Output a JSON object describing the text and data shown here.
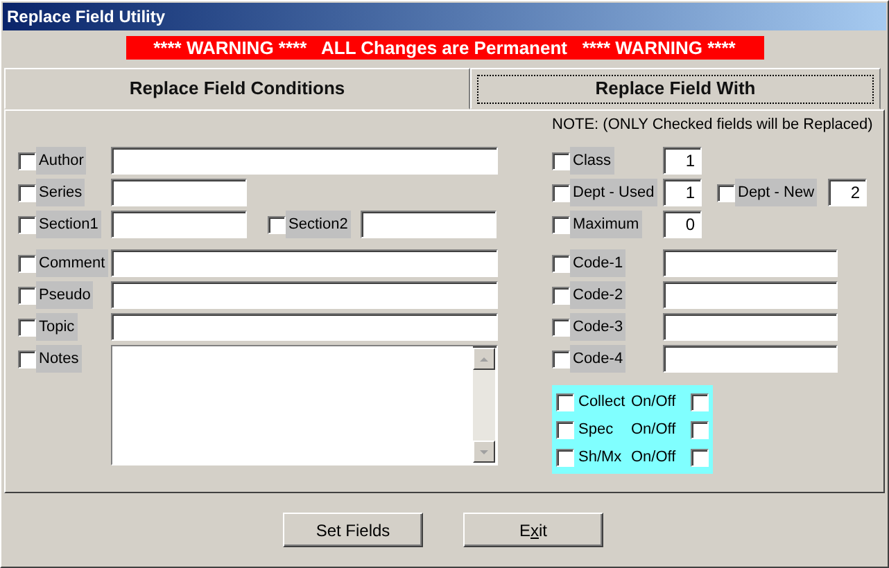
{
  "window": {
    "title": "Replace Field Utility"
  },
  "warning": "**** WARNING ****   ALL Changes are Permanent   **** WARNING ****",
  "sections": [
    {
      "header": "Replace Field Conditions",
      "focused": false
    },
    {
      "header": "Replace Field With",
      "focused": true
    }
  ],
  "note": "NOTE: (ONLY Checked fields will be Replaced)",
  "conditions": [
    [
      [
        {
          "label": "Author",
          "checked": false,
          "kind": "wide"
        }
      ],
      [
        {
          "label": "Series",
          "checked": false,
          "kind": "short"
        }
      ],
      [
        {
          "label": "Section1",
          "checked": false,
          "kind": "short"
        },
        {
          "label": "Section2",
          "checked": false,
          "kind": "short"
        }
      ]
    ],
    [
      [
        {
          "label": "Comment",
          "checked": false,
          "kind": "wide"
        }
      ],
      [
        {
          "label": "Pseudo",
          "checked": false,
          "kind": "wide"
        }
      ],
      [
        {
          "label": "Topic",
          "checked": false,
          "kind": "wide"
        }
      ],
      [
        {
          "label": "Notes",
          "checked": false,
          "kind": "notes"
        }
      ]
    ]
  ],
  "replacements": [
    [
      [
        {
          "label": "Class",
          "checked": false,
          "kind": "number",
          "value": "1"
        }
      ],
      [
        {
          "label": "Dept - Used",
          "checked": false,
          "kind": "number",
          "value": "1"
        },
        {
          "label": "Dept - New",
          "checked": false,
          "kind": "number",
          "value": "2"
        }
      ],
      [
        {
          "label": "Maximum",
          "checked": false,
          "kind": "number",
          "value": "0"
        }
      ]
    ],
    [
      [
        {
          "label": "Code-1",
          "checked": false,
          "kind": "code"
        }
      ],
      [
        {
          "label": "Code-2",
          "checked": false,
          "kind": "code"
        }
      ],
      [
        {
          "label": "Code-3",
          "checked": false,
          "kind": "code"
        }
      ],
      [
        {
          "label": "Code-4",
          "checked": false,
          "kind": "code"
        }
      ]
    ]
  ],
  "toggles": [
    {
      "label": "Collect",
      "checked": false,
      "switch_label": "On/Off",
      "on": false
    },
    {
      "label": "Spec",
      "checked": false,
      "switch_label": "On/Off",
      "on": false
    },
    {
      "label": "Sh/Mx",
      "checked": false,
      "switch_label": "On/Off",
      "on": false
    }
  ],
  "buttons": [
    {
      "label_parts": [
        {
          "text": "Set Fields",
          "underlined": false
        }
      ]
    },
    {
      "label_parts": [
        {
          "text": "E",
          "underlined": false
        },
        {
          "text": "x",
          "underlined": true
        },
        {
          "text": "it",
          "underlined": false
        }
      ]
    }
  ]
}
